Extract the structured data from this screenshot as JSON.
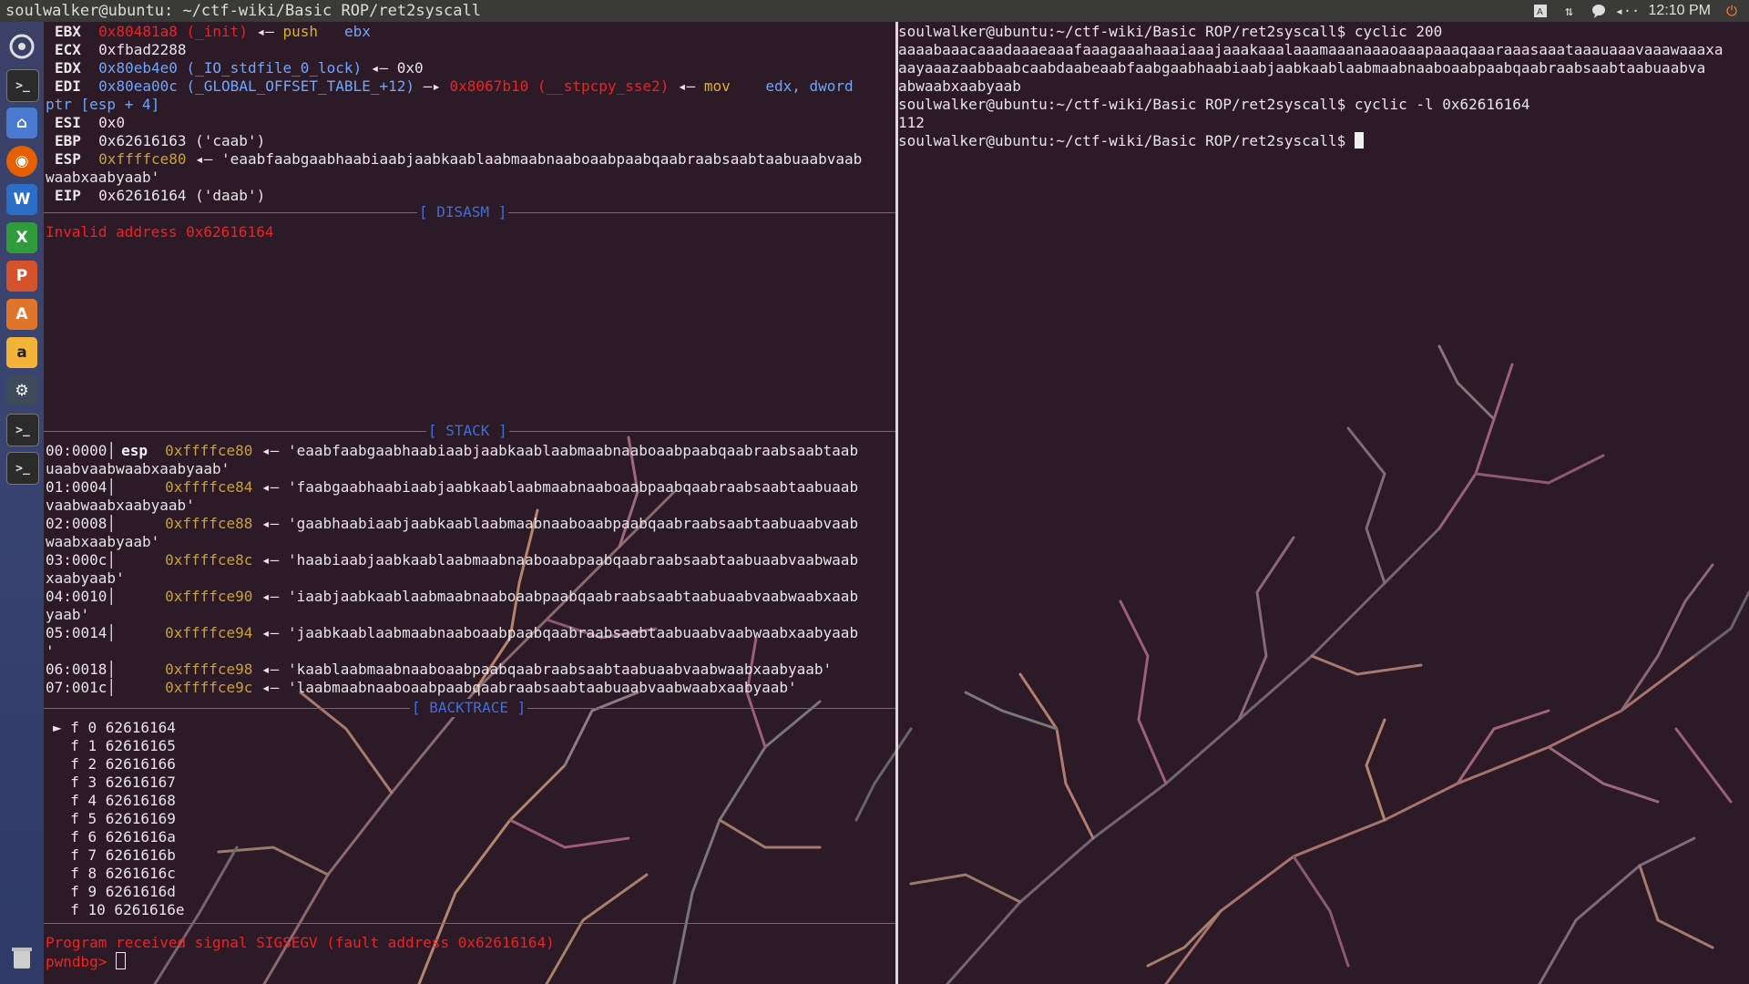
{
  "topbar": {
    "title": "soulwalker@ubuntu: ~/ctf-wiki/Basic ROP/ret2syscall",
    "clock": "12:10 PM",
    "icons": [
      "keyboard-icon",
      "network-icon",
      "chat-icon",
      "volume-icon",
      "power-icon"
    ]
  },
  "launcher": {
    "items": [
      "ubuntu-dash-icon",
      "terminal-icon",
      "files-icon",
      "firefox-icon",
      "writer-icon",
      "calc-icon",
      "impress-icon",
      "software-center-icon",
      "amazon-icon",
      "system-settings-icon",
      "terminal-icon-2",
      "terminal-icon-3",
      "trash-icon"
    ]
  },
  "registers": {
    "ebx": {
      "name": "EBX",
      "addr": "0x80481a8",
      "sym": "(_init)",
      "arrow": "◂—",
      "op": "push",
      "arg": "ebx"
    },
    "ecx": {
      "name": "ECX",
      "val": "0xfbad2288"
    },
    "edx": {
      "name": "EDX",
      "addr": "0x80eb4e0",
      "sym": "(_IO_stdfile_0_lock)",
      "arrow": "◂—",
      "val": "0x0"
    },
    "edi": {
      "name": "EDI",
      "addr": "0x80ea00c",
      "sym": "(_GLOBAL_OFFSET_TABLE_+12)",
      "arrow": "—▸",
      "addr2": "0x8067b10",
      "sym2": "(__stpcpy_sse2)",
      "arrow2": "◂—",
      "op": "mov",
      "arg": "edx, dword",
      "cont": "ptr [esp + 4]"
    },
    "esi": {
      "name": "ESI",
      "val": "0x0"
    },
    "ebp": {
      "name": "EBP",
      "val": "0x62616163 ('caab')"
    },
    "esp": {
      "name": "ESP",
      "addr": "0xffffce80",
      "arrow": "◂—",
      "val": "'eaabfaabgaabhaabiaabjaabkaablaabmaabnaaboaabpaabqaabraabsaabtaabuaabvaab",
      "cont": "waabxaabyaab'"
    },
    "eip": {
      "name": "EIP",
      "val": "0x62616164 ('daab')"
    }
  },
  "disasm": {
    "header": "[ DISASM ]",
    "line": "Invalid address 0x62616164"
  },
  "stack": {
    "header": "[ STACK ]",
    "rows": [
      {
        "off": "00:0000│",
        "reg": "esp",
        "addr": "0xffffce80",
        "arrow": "◂—",
        "val": "'eaabfaabgaabhaabiaabjaabkaablaabmaabnaaboaabpaabqaabraabsaabtaab",
        "cont": "uaabvaabwaabxaabyaab'"
      },
      {
        "off": "01:0004│",
        "reg": "",
        "addr": "0xffffce84",
        "arrow": "◂—",
        "val": "'faabgaabhaabiaabjaabkaablaabmaabnaaboaabpaabqaabraabsaabtaabuaab",
        "cont": "vaabwaabxaabyaab'"
      },
      {
        "off": "02:0008│",
        "reg": "",
        "addr": "0xffffce88",
        "arrow": "◂—",
        "val": "'gaabhaabiaabjaabkaablaabmaabnaaboaabpaabqaabraabsaabtaabuaabvaab",
        "cont": "waabxaabyaab'"
      },
      {
        "off": "03:000c│",
        "reg": "",
        "addr": "0xffffce8c",
        "arrow": "◂—",
        "val": "'haabiaabjaabkaablaabmaabnaaboaabpaabqaabraabsaabtaabuaabvaabwaab",
        "cont": "xaabyaab'"
      },
      {
        "off": "04:0010│",
        "reg": "",
        "addr": "0xffffce90",
        "arrow": "◂—",
        "val": "'iaabjaabkaablaabmaabnaaboaabpaabqaabraabsaabtaabuaabvaabwaabxaab",
        "cont": "yaab'"
      },
      {
        "off": "05:0014│",
        "reg": "",
        "addr": "0xffffce94",
        "arrow": "◂—",
        "val": "'jaabkaablaabmaabnaaboaabpaabqaabraabsaabtaabuaabvaabwaabxaabyaab",
        "cont": "'"
      },
      {
        "off": "06:0018│",
        "reg": "",
        "addr": "0xffffce98",
        "arrow": "◂—",
        "val": "'kaablaabmaabnaaboaabpaabqaabraabsaabtaabuaabvaabwaabxaabyaab'",
        "cont": ""
      },
      {
        "off": "07:001c│",
        "reg": "",
        "addr": "0xffffce9c",
        "arrow": "◂—",
        "val": "'laabmaabnaaboaabpaabqaabraabsaabtaabuaabvaabwaabxaabyaab'",
        "cont": ""
      }
    ]
  },
  "backtrace": {
    "header": "[ BACKTRACE ]",
    "frames": [
      "► f 0 62616164",
      "  f 1 62616165",
      "  f 2 62616166",
      "  f 3 62616167",
      "  f 4 62616168",
      "  f 5 62616169",
      "  f 6 6261616a",
      "  f 7 6261616b",
      "  f 8 6261616c",
      "  f 9 6261616d",
      "  f 10 6261616e"
    ]
  },
  "signal": "Program received signal SIGSEGV (fault address 0x62616164)",
  "prompt": "pwndbg> ",
  "right": {
    "lines": [
      "soulwalker@ubuntu:~/ctf-wiki/Basic ROP/ret2syscall$ cyclic 200",
      "aaaabaaacaaadaaaeaaafaaagaaahaaaiaaajaaakaaalaaamaaanaaaoaaapaaaqaaaraaasaaataaauaaavaaawaaaxa",
      "aayaaazaabbaabcaabdaabeaabfaabgaabhaabiaabjaabkaablaabmaabnaaboaabpaabqaabraabsaabtaabuaabva",
      "abwaabxaabyaab",
      "soulwalker@ubuntu:~/ctf-wiki/Basic ROP/ret2syscall$ cyclic -l 0x62616164",
      "112"
    ],
    "prompt": "soulwalker@ubuntu:~/ctf-wiki/Basic ROP/ret2syscall$ "
  }
}
